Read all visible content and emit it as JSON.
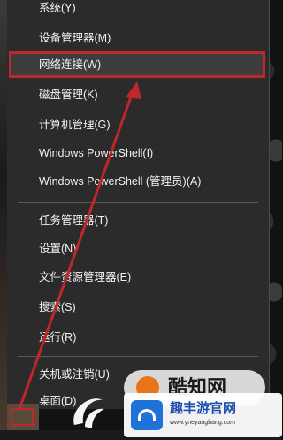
{
  "context_menu": {
    "items": [
      {
        "id": "system",
        "label": "系统(Y)"
      },
      {
        "id": "device-manager",
        "label": "设备管理器(M)"
      },
      {
        "id": "network-connections",
        "label": "网络连接(W)"
      },
      {
        "id": "disk-management",
        "label": "磁盘管理(K)"
      },
      {
        "id": "computer-management",
        "label": "计算机管理(G)"
      },
      {
        "id": "powershell",
        "label": "Windows PowerShell(I)"
      },
      {
        "id": "powershell-admin",
        "label": "Windows PowerShell (管理员)(A)"
      },
      {
        "id": "task-manager",
        "label": "任务管理器(T)"
      },
      {
        "id": "settings",
        "label": "设置(N)"
      },
      {
        "id": "file-explorer",
        "label": "文件资源管理器(E)"
      },
      {
        "id": "search",
        "label": "搜索(S)"
      },
      {
        "id": "run",
        "label": "运行(R)"
      },
      {
        "id": "shutdown",
        "label": "关机或注销(U)"
      },
      {
        "id": "desktop",
        "label": "桌面(D)"
      }
    ],
    "highlighted_item": "网络连接(W)"
  },
  "annotation": {
    "color": "#c0262c"
  },
  "watermarks": {
    "brand1": "酷知网",
    "brand2_title": "趣丰游官网",
    "brand2_url": "www.yneyangbang.com"
  }
}
